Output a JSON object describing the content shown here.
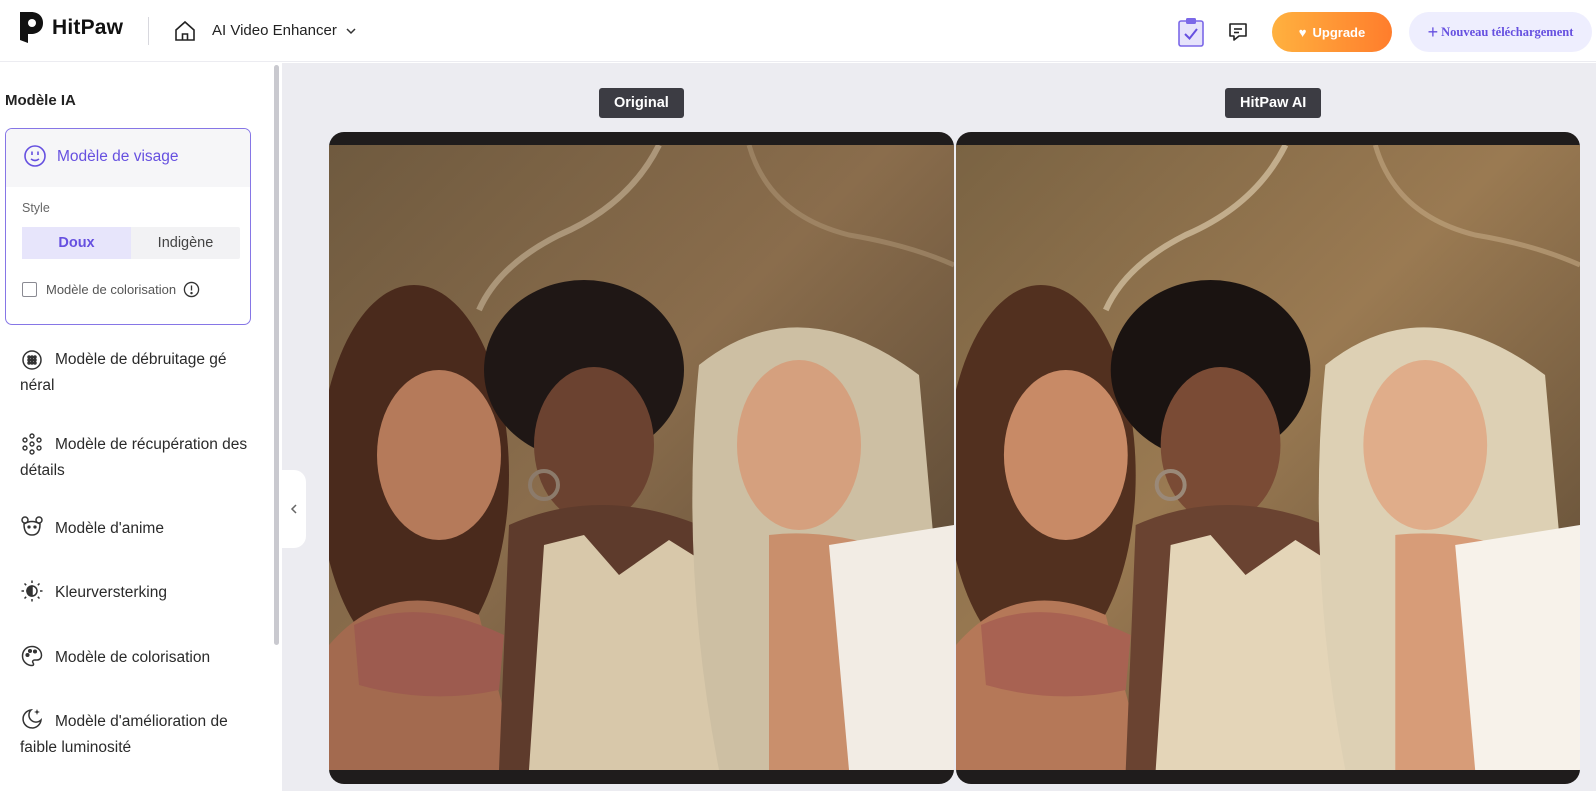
{
  "header": {
    "brand": "HitPaw",
    "app_title": "AI Video Enhancer",
    "upgrade_label": "Upgrade",
    "new_upload_label": "Nouveau téléchargement"
  },
  "sidebar": {
    "title": "Modèle IA",
    "face_model": {
      "label": "Modèle de visage",
      "style_label": "Style",
      "styles": [
        "Doux",
        "Indigène"
      ],
      "selected_style": "Doux",
      "colorize_label": "Modèle de colorisation",
      "colorize_checked": false
    },
    "models": [
      {
        "label": "Modèle de débruitage gé néral",
        "icon": "denoise-icon"
      },
      {
        "label": "Modèle de récupération des détails",
        "icon": "detail-dots-icon"
      },
      {
        "label": "Modèle d'anime",
        "icon": "anime-bear-icon"
      },
      {
        "label": "Kleurversterking",
        "icon": "sun-icon"
      },
      {
        "label": "Modèle de colorisation",
        "icon": "palette-icon"
      },
      {
        "label": "Modèle d'amélioration de faible luminosité",
        "icon": "moon-sparkle-icon"
      }
    ]
  },
  "preview": {
    "original_label": "Original",
    "enhanced_label": "HitPaw AI"
  },
  "colors": {
    "accent": "#6650e0",
    "upgrade_start": "#ffb13f",
    "upgrade_end": "#ff7d2c",
    "main_bg": "#ececf1",
    "tag_bg": "#3c3c43"
  }
}
